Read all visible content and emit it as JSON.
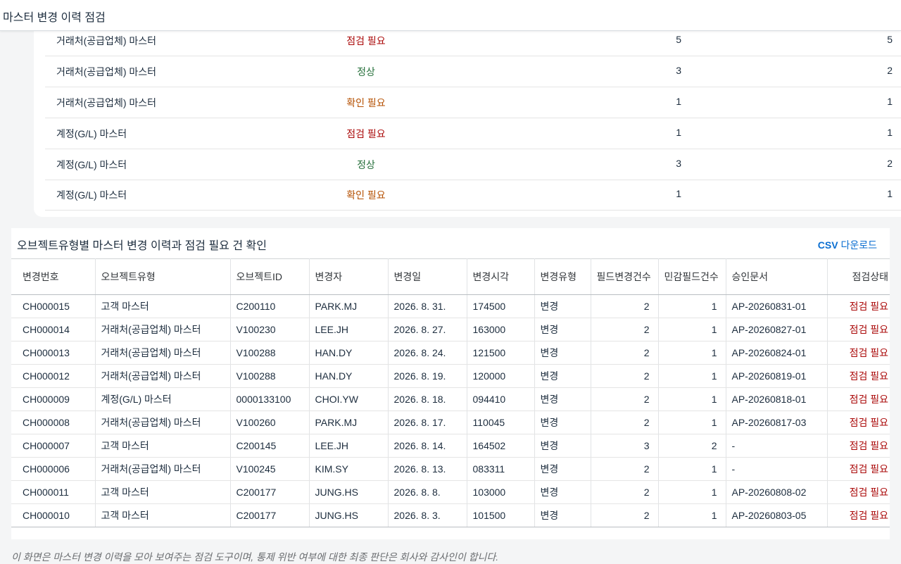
{
  "header": {
    "title": "마스터 변경 이력 점검"
  },
  "summary": {
    "rows": [
      {
        "type": "거래처(공급업체) 마스터",
        "status": "점검 필요",
        "status_kind": "red",
        "count1": "5",
        "count2": "5"
      },
      {
        "type": "거래처(공급업체) 마스터",
        "status": "정상",
        "status_kind": "green",
        "count1": "3",
        "count2": "2"
      },
      {
        "type": "거래처(공급업체) 마스터",
        "status": "확인 필요",
        "status_kind": "orange",
        "count1": "1",
        "count2": "1"
      },
      {
        "type": "계정(G/L) 마스터",
        "status": "점검 필요",
        "status_kind": "red",
        "count1": "1",
        "count2": "1"
      },
      {
        "type": "계정(G/L) 마스터",
        "status": "정상",
        "status_kind": "green",
        "count1": "3",
        "count2": "2"
      },
      {
        "type": "계정(G/L) 마스터",
        "status": "확인 필요",
        "status_kind": "orange",
        "count1": "1",
        "count2": "1"
      }
    ]
  },
  "detail": {
    "title": "오브젝트유형별 마스터 변경 이력과 점검 필요 건 확인",
    "csv_label_bold": "CSV",
    "csv_label_rest": " 다운로드",
    "columns": [
      "변경번호",
      "오브젝트유형",
      "오브젝트ID",
      "변경자",
      "변경일",
      "변경시각",
      "변경유형",
      "필드변경건수",
      "민감필드건수",
      "승인문서",
      "점검상태"
    ],
    "rows": [
      [
        "CH000015",
        "고객 마스터",
        "C200110",
        "PARK.MJ",
        "2026. 8. 31.",
        "174500",
        "변경",
        "2",
        "1",
        "AP-20260831-01",
        "점검 필요"
      ],
      [
        "CH000014",
        "거래처(공급업체) 마스터",
        "V100230",
        "LEE.JH",
        "2026. 8. 27.",
        "163000",
        "변경",
        "2",
        "1",
        "AP-20260827-01",
        "점검 필요"
      ],
      [
        "CH000013",
        "거래처(공급업체) 마스터",
        "V100288",
        "HAN.DY",
        "2026. 8. 24.",
        "121500",
        "변경",
        "2",
        "1",
        "AP-20260824-01",
        "점검 필요"
      ],
      [
        "CH000012",
        "거래처(공급업체) 마스터",
        "V100288",
        "HAN.DY",
        "2026. 8. 19.",
        "120000",
        "변경",
        "2",
        "1",
        "AP-20260819-01",
        "점검 필요"
      ],
      [
        "CH000009",
        "계정(G/L) 마스터",
        "0000133100",
        "CHOI.YW",
        "2026. 8. 18.",
        "094410",
        "변경",
        "2",
        "1",
        "AP-20260818-01",
        "점검 필요"
      ],
      [
        "CH000008",
        "거래처(공급업체) 마스터",
        "V100260",
        "PARK.MJ",
        "2026. 8. 17.",
        "110045",
        "변경",
        "2",
        "1",
        "AP-20260817-03",
        "점검 필요"
      ],
      [
        "CH000007",
        "고객 마스터",
        "C200145",
        "LEE.JH",
        "2026. 8. 14.",
        "164502",
        "변경",
        "3",
        "2",
        "-",
        "점검 필요"
      ],
      [
        "CH000006",
        "거래처(공급업체) 마스터",
        "V100245",
        "KIM.SY",
        "2026. 8. 13.",
        "083311",
        "변경",
        "2",
        "1",
        "-",
        "점검 필요"
      ],
      [
        "CH000011",
        "고객 마스터",
        "C200177",
        "JUNG.HS",
        "2026. 8. 8.",
        "103000",
        "변경",
        "2",
        "1",
        "AP-20260808-02",
        "점검 필요"
      ],
      [
        "CH000010",
        "고객 마스터",
        "C200177",
        "JUNG.HS",
        "2026. 8. 3.",
        "101500",
        "변경",
        "2",
        "1",
        "AP-20260803-05",
        "점검 필요"
      ]
    ]
  },
  "footnote": "이 화면은 마스터 변경 이력을 모아 보여주는 점검 도구이며, 통제 위반 여부에 대한 최종 판단은 회사와 감사인이 합니다.",
  "colors": {
    "red": "#aa0808",
    "green": "#256f3a",
    "orange": "#b44f00",
    "link": "#0a6ed1"
  }
}
